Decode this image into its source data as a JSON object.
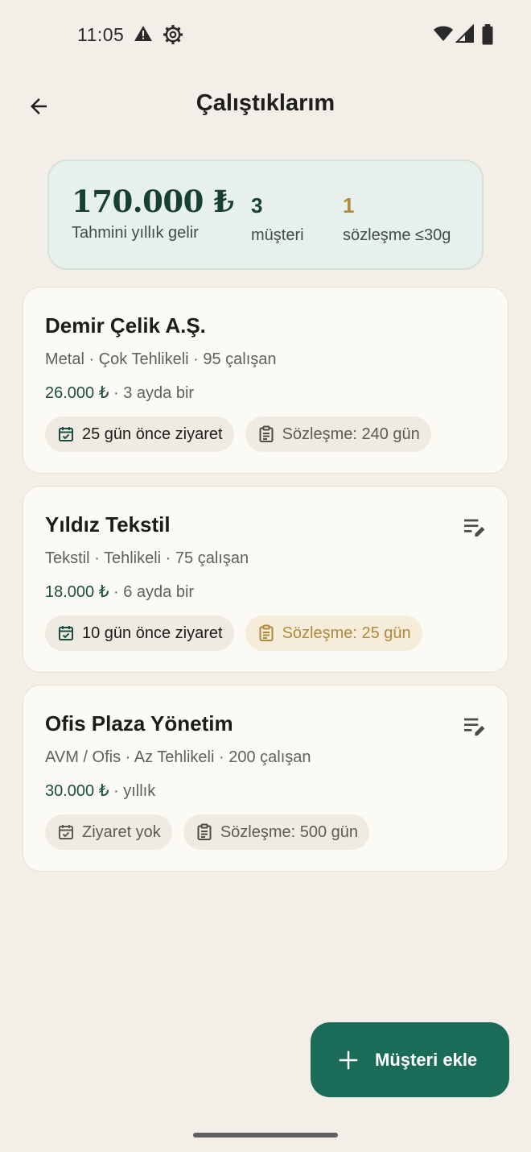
{
  "status_bar": {
    "time": "11:05"
  },
  "header": {
    "title": "Çalıştıklarım"
  },
  "summary": {
    "income_value": "170.000 ₺",
    "income_label": "Tahmini yıllık gelir",
    "clients_count": "3",
    "clients_label": "müşteri",
    "contracts_count": "1",
    "contracts_label": "sözleşme ≤30g",
    "colors": {
      "income": "#173f33",
      "clients": "#173f33",
      "contracts": "#b08a3c"
    }
  },
  "clients": [
    {
      "name": "Demir Çelik A.Ş.",
      "meta": "Metal · Çok Tehlikeli · 95 çalışan",
      "fee_amount": "26.000  ₺",
      "fee_freq": " · 3 ayda bir",
      "visit": "25 gün önce ziyaret",
      "contract": "Sözleşme: 240 gün",
      "show_edit": false
    },
    {
      "name": "Yıldız Tekstil",
      "meta": "Tekstil · Tehlikeli · 75 çalışan",
      "fee_amount": "18.000  ₺",
      "fee_freq": " · 6 ayda bir",
      "visit": "10 gün önce ziyaret",
      "contract": "Sözleşme: 25 gün",
      "show_edit": true
    },
    {
      "name": "Ofis Plaza Yönetim",
      "meta": "AVM / Ofis · Az Tehlikeli · 200 çalışan",
      "fee_amount": "30.000  ₺",
      "fee_freq": " · yıllık",
      "visit": "Ziyaret yok",
      "contract": "Sözleşme: 500 gün",
      "show_edit": true
    }
  ],
  "fab": {
    "label": "Müşteri ekle",
    "icon": "plus-icon"
  },
  "icons": [
    "warning-icon",
    "settings-icon",
    "wifi-icon",
    "signal-icon",
    "battery-icon",
    "arrow-back-icon",
    "calendar-check-icon",
    "clipboard-icon",
    "edit-note-icon"
  ]
}
